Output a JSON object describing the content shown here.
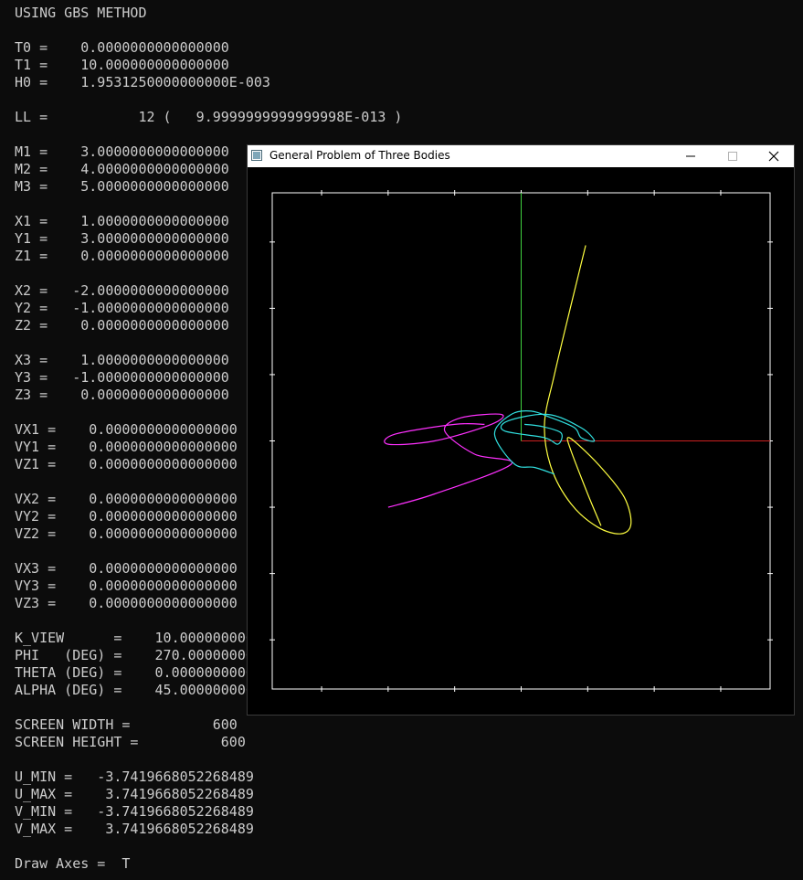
{
  "console": {
    "lines": [
      "USING GBS METHOD",
      "",
      "T0 =    0.0000000000000000",
      "T1 =    10.000000000000000",
      "H0 =    1.9531250000000000E-003",
      "",
      "LL =           12 (   9.9999999999999998E-013 )",
      "",
      "M1 =    3.0000000000000000",
      "M2 =    4.0000000000000000",
      "M3 =    5.0000000000000000",
      "",
      "X1 =    1.0000000000000000",
      "Y1 =    3.0000000000000000",
      "Z1 =    0.0000000000000000",
      "",
      "X2 =   -2.0000000000000000",
      "Y2 =   -1.0000000000000000",
      "Z2 =    0.0000000000000000",
      "",
      "X3 =    1.0000000000000000",
      "Y3 =   -1.0000000000000000",
      "Z3 =    0.0000000000000000",
      "",
      "VX1 =    0.0000000000000000",
      "VY1 =    0.0000000000000000",
      "VZ1 =    0.0000000000000000",
      "",
      "VX2 =    0.0000000000000000",
      "VY2 =    0.0000000000000000",
      "VZ2 =    0.0000000000000000",
      "",
      "VX3 =    0.0000000000000000",
      "VY3 =    0.0000000000000000",
      "VZ3 =    0.0000000000000000",
      "",
      "K_VIEW      =    10.000000000",
      "PHI   (DEG) =    270.00000000",
      "THETA (DEG) =    0.0000000000",
      "ALPHA (DEG) =    45.000000000",
      "",
      "SCREEN WIDTH =          600",
      "SCREEN HEIGHT =          600",
      "",
      "U_MIN =   -3.7419668052268489",
      "U_MAX =    3.7419668052268489",
      "V_MIN =   -3.7419668052268489",
      "V_MAX =    3.7419668052268489",
      "",
      "Draw Axes =  T"
    ]
  },
  "window": {
    "title": "General Problem of Three Bodies",
    "minimize_glyph": "—",
    "maximize_glyph": "☐",
    "close_glyph": "✕"
  },
  "plot": {
    "u_min": -3.741966805226849,
    "u_max": 3.741966805226849,
    "v_min": -3.741966805226849,
    "v_max": 3.741966805226849,
    "draw_axes": true,
    "colors": {
      "frame": "#ffffff",
      "axis_x": "#cc2020",
      "axis_y": "#40d040",
      "body1": "#ffff40",
      "body2": "#ff30ff",
      "body3": "#30e0e0"
    },
    "trajectories": [
      {
        "name": "body1",
        "points": [
          [
            0.97,
            2.95
          ],
          [
            0.75,
            2.05
          ],
          [
            0.5,
            1.0
          ],
          [
            0.35,
            0.25
          ],
          [
            0.45,
            -0.4
          ],
          [
            0.75,
            -0.95
          ],
          [
            1.15,
            -1.3
          ],
          [
            1.5,
            -1.4
          ],
          [
            1.65,
            -1.25
          ],
          [
            1.55,
            -0.85
          ],
          [
            1.2,
            -0.4
          ],
          [
            0.85,
            -0.05
          ],
          [
            0.7,
            0.05
          ],
          [
            0.75,
            -0.15
          ],
          [
            1.0,
            -0.8
          ],
          [
            1.2,
            -1.28
          ]
        ]
      },
      {
        "name": "body2",
        "points": [
          [
            -2.0,
            -1.0
          ],
          [
            -1.3,
            -0.8
          ],
          [
            -0.15,
            -0.35
          ],
          [
            -0.7,
            -0.2
          ],
          [
            -1.15,
            0.15
          ],
          [
            -0.9,
            0.35
          ],
          [
            -0.3,
            0.4
          ],
          [
            -0.45,
            0.25
          ],
          [
            -1.3,
            0.0
          ],
          [
            -2.0,
            -0.05
          ],
          [
            -1.9,
            0.1
          ],
          [
            -1.0,
            0.25
          ],
          [
            -0.55,
            0.25
          ]
        ]
      },
      {
        "name": "body3",
        "points": [
          [
            0.5,
            -0.5
          ],
          [
            0.2,
            -0.4
          ],
          [
            -0.1,
            -0.35
          ],
          [
            -0.4,
            0.1
          ],
          [
            -0.15,
            0.4
          ],
          [
            0.15,
            0.45
          ],
          [
            0.45,
            0.35
          ],
          [
            0.8,
            0.2
          ],
          [
            0.9,
            0.05
          ],
          [
            1.1,
            0.0
          ],
          [
            0.9,
            0.2
          ],
          [
            0.4,
            0.4
          ],
          [
            -0.2,
            0.3
          ],
          [
            -0.25,
            0.15
          ],
          [
            0.35,
            0.05
          ],
          [
            0.55,
            -0.05
          ],
          [
            0.6,
            0.12
          ],
          [
            0.3,
            0.22
          ],
          [
            0.05,
            0.25
          ]
        ]
      }
    ]
  }
}
